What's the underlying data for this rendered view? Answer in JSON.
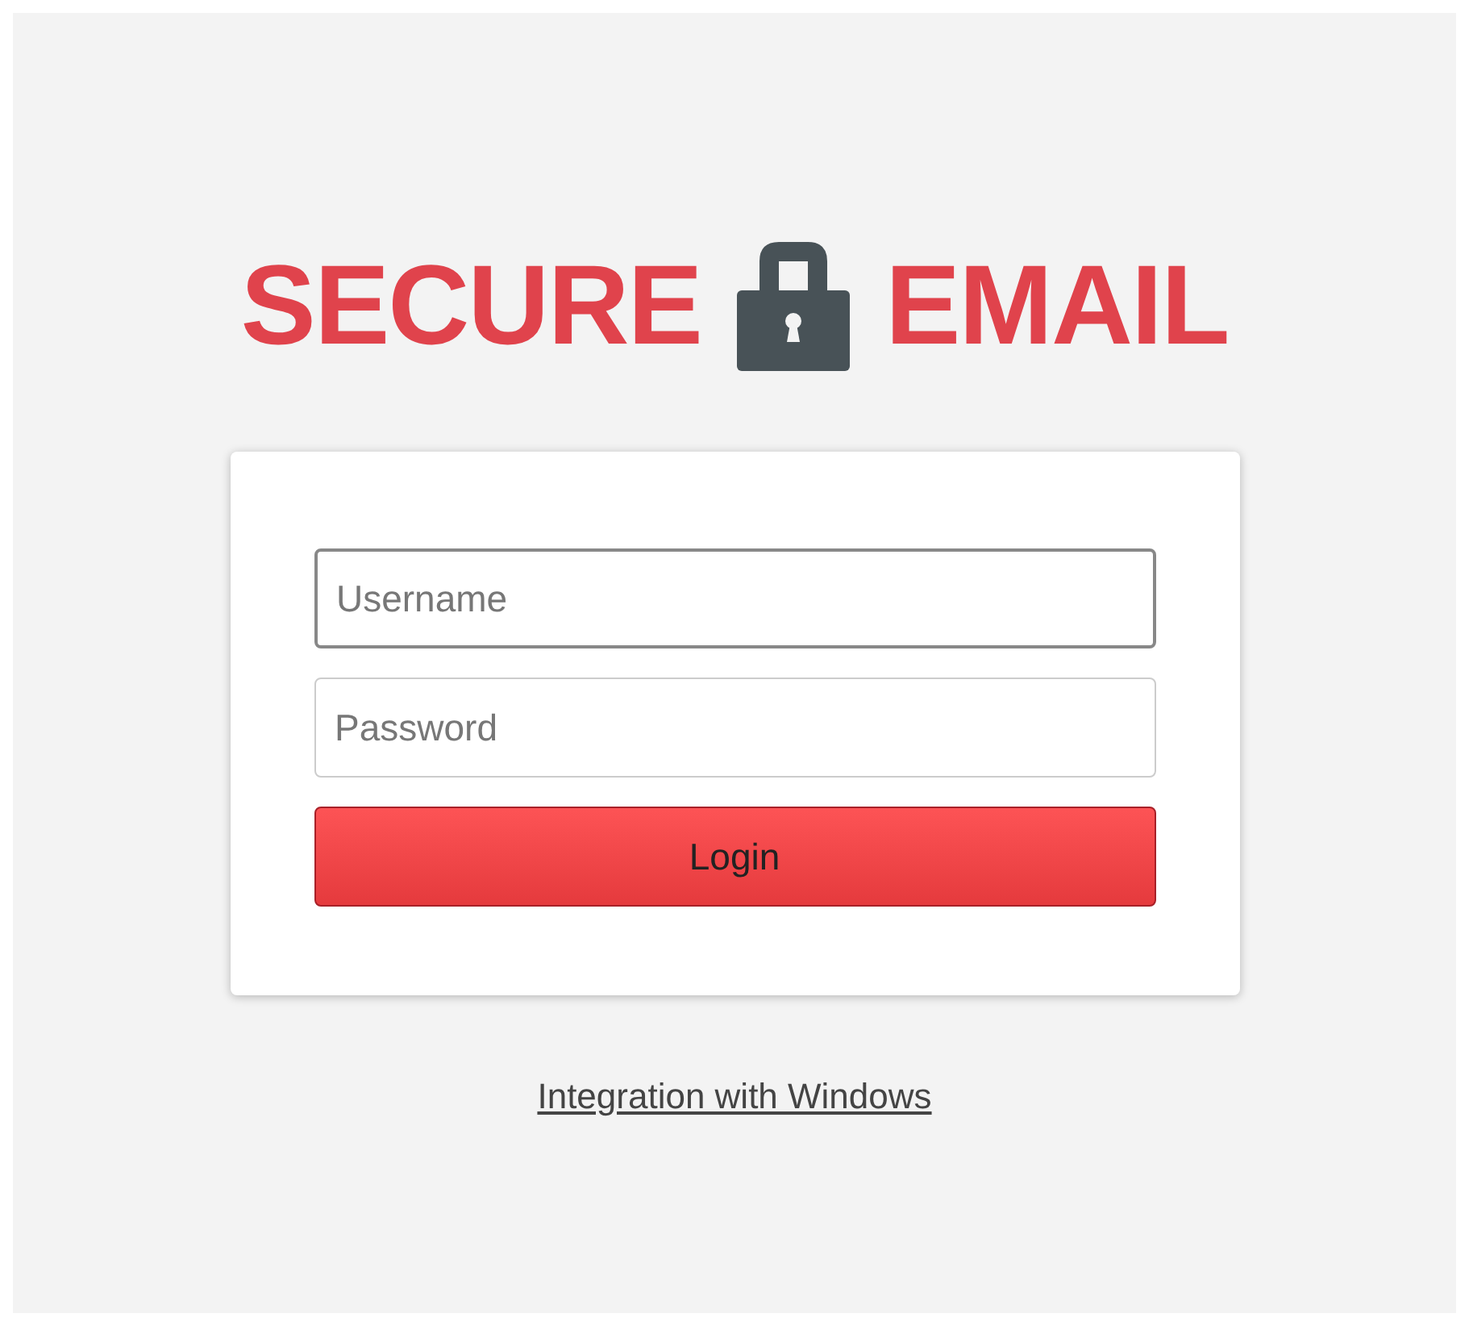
{
  "logo": {
    "left_text": "SECURE",
    "right_text": "EMAIL"
  },
  "login_form": {
    "fields": [
      {
        "placeholder": "Username",
        "focused": true
      },
      {
        "placeholder": "Password",
        "focused": false
      }
    ],
    "button": "Login"
  },
  "link": "Integration with Windows"
}
